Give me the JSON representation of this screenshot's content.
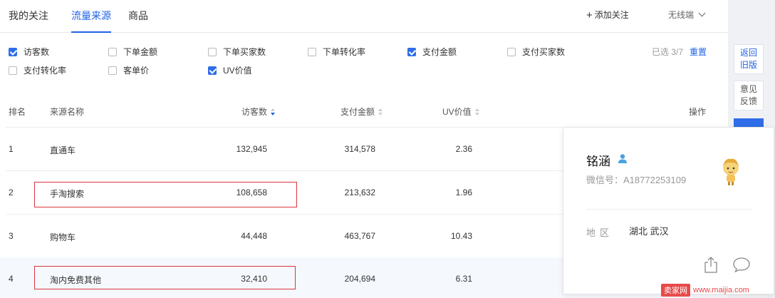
{
  "tabs": [
    {
      "label": "我的关注"
    },
    {
      "label": "流量来源"
    },
    {
      "label": "商品"
    }
  ],
  "header": {
    "add_follow": "添加关注",
    "device": "无线端"
  },
  "metrics": [
    {
      "label": "访客数",
      "checked": true
    },
    {
      "label": "下单金额",
      "checked": false
    },
    {
      "label": "下单买家数",
      "checked": false
    },
    {
      "label": "下单转化率",
      "checked": false
    },
    {
      "label": "支付金额",
      "checked": true
    },
    {
      "label": "支付买家数",
      "checked": false
    },
    {
      "label": "支付转化率",
      "checked": false
    },
    {
      "label": "客单价",
      "checked": false
    },
    {
      "label": "UV价值",
      "checked": true
    }
  ],
  "selection": {
    "count": "已选 3/7",
    "reset": "重置"
  },
  "table": {
    "headers": {
      "rank": "排名",
      "source": "来源名称",
      "visitors": "访客数",
      "pay": "支付金额",
      "uv": "UV价值",
      "action": "操作"
    },
    "rows": [
      {
        "rank": "1",
        "source": "直通车",
        "visitors": "132,945",
        "pay": "314,578",
        "uv": "2.36"
      },
      {
        "rank": "2",
        "source": "手淘搜索",
        "visitors": "108,658",
        "pay": "213,632",
        "uv": "1.96"
      },
      {
        "rank": "3",
        "source": "购物车",
        "visitors": "44,448",
        "pay": "463,767",
        "uv": "10.43"
      },
      {
        "rank": "4",
        "source": "淘内免费其他",
        "visitors": "32,410",
        "pay": "204,694",
        "uv": "6.31"
      }
    ]
  },
  "profile": {
    "name": "铭涵",
    "wechat": "微信号：A18772253109",
    "region_label": "地区",
    "region_value": "湖北 武汉"
  },
  "side": {
    "back": [
      "返回",
      "旧版"
    ],
    "feedback": [
      "意见",
      "反馈"
    ]
  },
  "watermark": {
    "badge": "卖家网",
    "url": "www.maijia.com"
  },
  "colors": {
    "accent": "#2062e6",
    "highlight_box": "#d9363e"
  }
}
